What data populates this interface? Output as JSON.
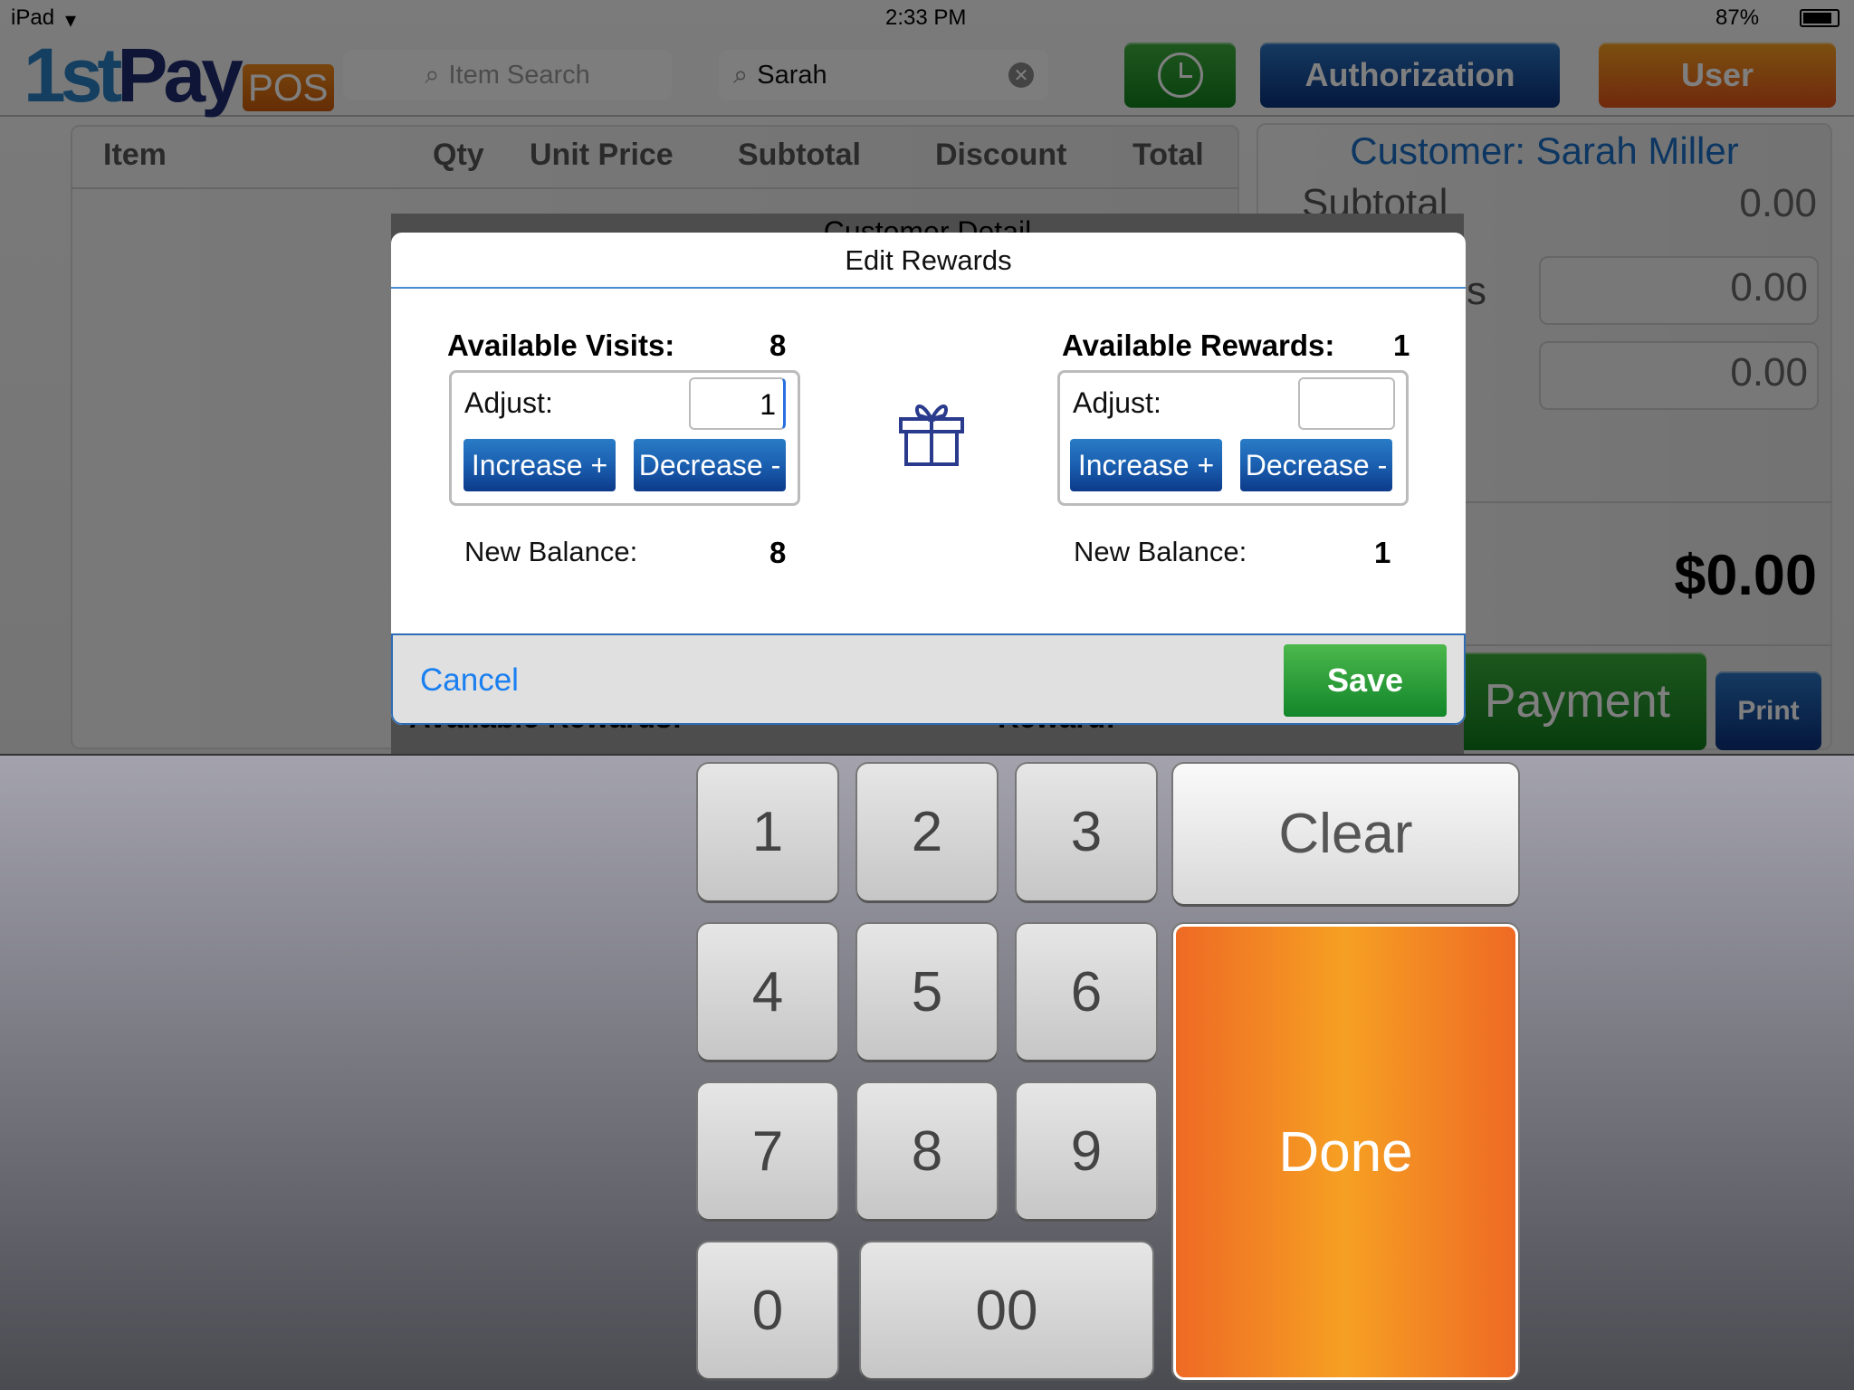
{
  "status_bar": {
    "device": "iPad",
    "time": "2:33 PM",
    "battery": "87%"
  },
  "header": {
    "logo": {
      "part1": "1st",
      "part2": "Pay",
      "part3": "POS"
    },
    "item_search_placeholder": "Item Search",
    "customer_search_value": "Sarah",
    "authorization_label": "Authorization",
    "user_label": "User"
  },
  "cart": {
    "columns": [
      "Item",
      "Qty",
      "Unit Price",
      "Subtotal",
      "Discount",
      "Total"
    ]
  },
  "summary": {
    "customer": "Customer: Sarah Miller",
    "subtotal_label": "Subtotal",
    "subtotal": "0.00",
    "partial_label": "s",
    "field1": "0.00",
    "field2": "0.00",
    "total": "$0.00",
    "payment_label": "Payment",
    "print_label": "Print"
  },
  "background_dialog": {
    "title": "Customer Detail",
    "available_rewards_label": "Available Rewards:",
    "reward_label": "Reward:"
  },
  "dialog": {
    "title": "Edit Rewards",
    "visits": {
      "label": "Available Visits:",
      "value": "8",
      "adjust_label": "Adjust:",
      "adjust_value": "1",
      "increase": "Increase +",
      "decrease": "Decrease -",
      "new_balance_label": "New Balance:",
      "new_balance": "8"
    },
    "rewards": {
      "label": "Available Rewards:",
      "value": "1",
      "adjust_label": "Adjust:",
      "adjust_value": "",
      "increase": "Increase +",
      "decrease": "Decrease -",
      "new_balance_label": "New Balance:",
      "new_balance": "1"
    },
    "cancel_label": "Cancel",
    "save_label": "Save"
  },
  "keypad": {
    "keys": [
      "1",
      "2",
      "3",
      "4",
      "5",
      "6",
      "7",
      "8",
      "9",
      "0",
      "00"
    ],
    "clear_label": "Clear",
    "done_label": "Done"
  },
  "colors": {
    "accent_blue": "#1a6fd8",
    "save_green": "#1f9a3a",
    "done_orange": "#f0892a"
  }
}
